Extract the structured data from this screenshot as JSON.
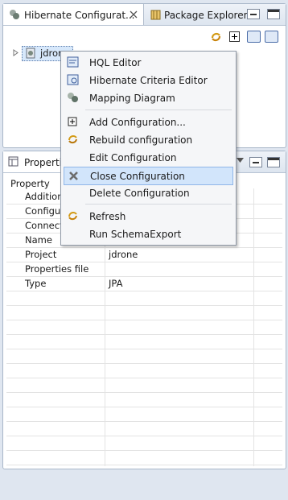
{
  "tabs": {
    "hibernate": "Hibernate Configurat...",
    "package_explorer": "Package Explorer"
  },
  "tree": {
    "node": "jdrone"
  },
  "properties": {
    "tab": "Properties",
    "header": "Property",
    "rows": [
      {
        "name": "Addition",
        "value": ""
      },
      {
        "name": "Configu",
        "value": ""
      },
      {
        "name": "Connect",
        "value": ""
      },
      {
        "name": "Name",
        "value": "jdrone"
      },
      {
        "name": "Project",
        "value": "jdrone"
      },
      {
        "name": "Properties file",
        "value": ""
      },
      {
        "name": "Type",
        "value": "JPA"
      }
    ]
  },
  "menu": {
    "items": [
      {
        "label": "HQL Editor",
        "icon": "hql-editor-icon"
      },
      {
        "label": "Hibernate Criteria Editor",
        "icon": "criteria-editor-icon"
      },
      {
        "label": "Mapping Diagram",
        "icon": "mapping-diagram-icon"
      },
      {
        "label": "Add Configuration...",
        "icon": "add-icon"
      },
      {
        "label": "Rebuild configuration",
        "icon": "rebuild-icon"
      },
      {
        "label": "Edit Configuration",
        "icon": ""
      },
      {
        "label": "Close Configuration",
        "icon": "close-config-icon",
        "selected": true
      },
      {
        "label": "Delete Configuration",
        "icon": ""
      },
      {
        "label": "Refresh",
        "icon": "refresh-icon"
      },
      {
        "label": "Run SchemaExport",
        "icon": ""
      }
    ]
  },
  "colors": {
    "selection": "#d2e5fb",
    "panel_border": "#a9b7c9",
    "background": "#dfe6f0"
  }
}
